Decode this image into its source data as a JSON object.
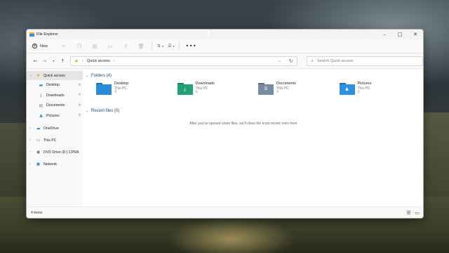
{
  "window": {
    "title": "File Explorer",
    "controls": [
      "minimize",
      "maximize",
      "close"
    ]
  },
  "ribbon": {
    "new_label": "New",
    "icons": [
      "cut-icon",
      "copy-icon",
      "paste-icon",
      "rename-icon",
      "share-icon",
      "delete-icon",
      "sort-icon",
      "view-icon",
      "more-icon"
    ],
    "more_glyph": "•••"
  },
  "address": {
    "crumb": "Quick access"
  },
  "search": {
    "placeholder": "Search Quick access"
  },
  "sidebar": {
    "quick_access": "Quick access",
    "pinned": [
      {
        "label": "Desktop",
        "icon": "desktop-icon"
      },
      {
        "label": "Downloads",
        "icon": "downloads-icon"
      },
      {
        "label": "Documents",
        "icon": "documents-icon"
      },
      {
        "label": "Pictures",
        "icon": "pictures-icon"
      }
    ],
    "onedrive": "OneDrive",
    "this_pc": "This PC",
    "dvd": "DVD Drive (D:) CPRA",
    "network": "Network"
  },
  "content": {
    "folders_header": "Folders (4)",
    "folders": [
      {
        "name": "Desktop",
        "location": "This PC",
        "color": "#2a8bd6"
      },
      {
        "name": "Downloads",
        "location": "This PC",
        "color": "#22a07a"
      },
      {
        "name": "Documents",
        "location": "This PC",
        "color": "#7b8aa3"
      },
      {
        "name": "Pictures",
        "location": "This PC",
        "color": "#2f8fe0"
      }
    ],
    "recent_header": "Recent files (0)",
    "empty_message": "After you've opened some files, we'll show the most recent ones here."
  },
  "status": {
    "item_count": "4 items"
  },
  "colors": {
    "accent": "#1f4a7a",
    "folder_yellow": "#f5b912"
  }
}
